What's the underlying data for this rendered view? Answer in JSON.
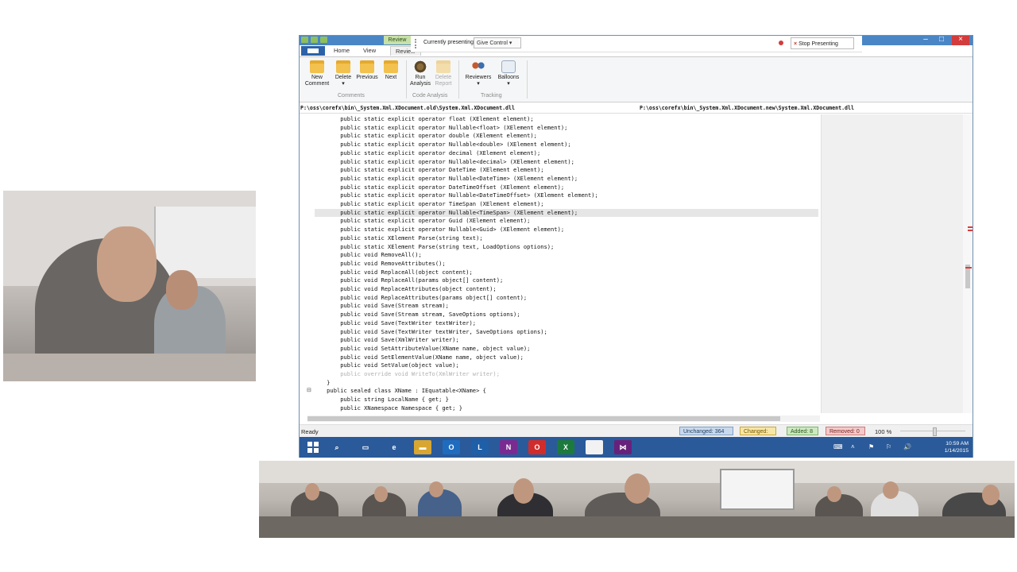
{
  "window": {
    "qat_label": "",
    "context_tab": "Review",
    "controls": {
      "minimize": "–",
      "maximize": "□",
      "close": "×"
    }
  },
  "presenting": {
    "label": "Currently presenting",
    "give_control": "Give Control ▾",
    "stop_presenting": "Stop Presenting",
    "stop_icon": "×"
  },
  "ribbon": {
    "tabs": [
      {
        "label": "Home"
      },
      {
        "label": "View"
      },
      {
        "label": "Review"
      }
    ],
    "buttons": [
      {
        "label": "New\nComment",
        "l1": "New",
        "l2": "Comment",
        "icon": "folder-icon"
      },
      {
        "label": "Delete",
        "l1": "Delete",
        "l2": "▾",
        "icon": "folder-icon"
      },
      {
        "label": "Previous",
        "l1": "Previous",
        "l2": "",
        "icon": "folder-icon"
      },
      {
        "label": "Next",
        "l1": "Next",
        "l2": "",
        "icon": "folder-icon"
      },
      {
        "label": "Run\nAnalysis",
        "l1": "Run",
        "l2": "Analysis",
        "icon": "gear-icon"
      },
      {
        "label": "Delete\nReport",
        "l1": "Delete",
        "l2": "Report",
        "icon": "report-icon"
      },
      {
        "label": "Reviewers",
        "l1": "Reviewers",
        "l2": "▾",
        "icon": "people-icon"
      },
      {
        "label": "Balloons",
        "l1": "Balloons",
        "l2": "▾",
        "icon": "balloon-icon"
      }
    ],
    "groups": [
      "Comments",
      "Code Analysis",
      "Tracking"
    ]
  },
  "paths": {
    "left": "P:\\oss\\corefx\\bin\\_System.Xml.XDocument.old\\System.Xml.XDocument.dll",
    "right": "P:\\oss\\corefx\\bin\\_System.Xml.XDocument.new\\System.Xml.XDocument.dll"
  },
  "code": {
    "lines": [
      "            public static explicit operator float (XElement element);",
      "            public static explicit operator Nullable<float> (XElement element);",
      "            public static explicit operator double (XElement element);",
      "            public static explicit operator Nullable<double> (XElement element);",
      "            public static explicit operator decimal (XElement element);",
      "            public static explicit operator Nullable<decimal> (XElement element);",
      "            public static explicit operator DateTime (XElement element);",
      "            public static explicit operator Nullable<DateTime> (XElement element);",
      "            public static explicit operator DateTimeOffset (XElement element);",
      "            public static explicit operator Nullable<DateTimeOffset> (XElement element);",
      "            public static explicit operator TimeSpan (XElement element);",
      "            public static explicit operator Nullable<TimeSpan> (XElement element);",
      "            public static explicit operator Guid (XElement element);",
      "            public static explicit operator Nullable<Guid> (XElement element);",
      "            public static XElement Parse(string text);",
      "            public static XElement Parse(string text, LoadOptions options);",
      "            public void RemoveAll();",
      "            public void RemoveAttributes();",
      "            public void ReplaceAll(object content);",
      "            public void ReplaceAll(params object[] content);",
      "            public void ReplaceAttributes(object content);",
      "            public void ReplaceAttributes(params object[] content);",
      "            public void Save(Stream stream);",
      "            public void Save(Stream stream, SaveOptions options);",
      "            public void Save(TextWriter textWriter);",
      "            public void Save(TextWriter textWriter, SaveOptions options);",
      "            public void Save(XmlWriter writer);",
      "            public void SetAttributeValue(XName name, object value);",
      "            public void SetElementValue(XName name, object value);",
      "            public void SetValue(object value);",
      "            public override void WriteTo(XmlWriter writer);",
      "        }",
      "        public sealed class XName : IEquatable<XName> {",
      "            public string LocalName { get; }",
      "            public XNamespace Namespace { get; }"
    ],
    "highlighted_line": 11,
    "ghost_line": 30,
    "collapse_line": 32,
    "collapse_symbol": "⊟"
  },
  "status": {
    "ready": "Ready",
    "unchanged": "Unchanged: 364",
    "changed": "Changed: 0",
    "added": "Added: 8",
    "removed": "Removed: 0",
    "zoom": "100 %"
  },
  "taskbar": {
    "apps": [
      {
        "name": "search-icon",
        "glyph": "⌕",
        "color": "#2a5a9a"
      },
      {
        "name": "file-explorer-icon",
        "glyph": "▭",
        "color": "#2a5a9a"
      },
      {
        "name": "internet-explorer-icon",
        "glyph": "e",
        "color": "#2a5a9a"
      },
      {
        "name": "folder-icon",
        "glyph": "▬",
        "color": "#d9a631"
      },
      {
        "name": "outlook-icon",
        "glyph": "O",
        "color": "#1f6cbf"
      },
      {
        "name": "lync-icon",
        "glyph": "L",
        "color": "#1e5fa8"
      },
      {
        "name": "onenote-icon",
        "glyph": "N",
        "color": "#7a2b91"
      },
      {
        "name": "opera-icon",
        "glyph": "O",
        "color": "#d12c2c"
      },
      {
        "name": "excel-icon",
        "glyph": "X",
        "color": "#1c7a3c"
      },
      {
        "name": "document-icon",
        "glyph": "",
        "color": "#f2f2f2"
      },
      {
        "name": "visual-studio-icon",
        "glyph": "⋈",
        "color": "#68217a"
      }
    ],
    "tray": [
      "⌨",
      "˄",
      "⚑",
      "⚐",
      "🔊"
    ],
    "time": "10:59 AM",
    "date": "1/14/2015"
  },
  "colors": {
    "accent": "#4a86c6",
    "taskbar": "#2a5a9a",
    "diff_removed": "#e03a3a"
  }
}
